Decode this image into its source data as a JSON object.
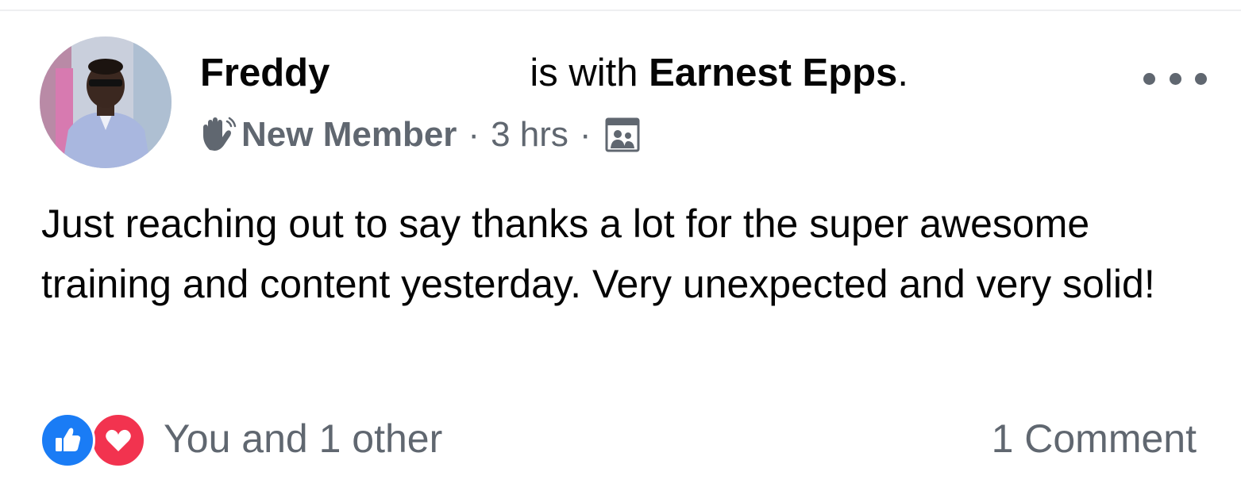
{
  "post": {
    "author": "Freddy",
    "with_text": "is with",
    "tagged_user": "Earnest Epps",
    "period": ".",
    "badge": "New Member",
    "separator": "·",
    "timestamp": "3 hrs",
    "audience_icon": "group-members-icon",
    "text": "Just reaching out to say thanks a lot for the super awesome training and content yesterday. Very unexpected and very solid!",
    "reactions": {
      "icons": [
        "like-icon",
        "love-icon"
      ],
      "summary": "You and 1 other"
    },
    "comments": "1 Comment"
  },
  "colors": {
    "like_blue": "#1a7cf5",
    "love_red": "#f2334f",
    "secondary_text": "#606770",
    "primary_text": "#050505"
  }
}
